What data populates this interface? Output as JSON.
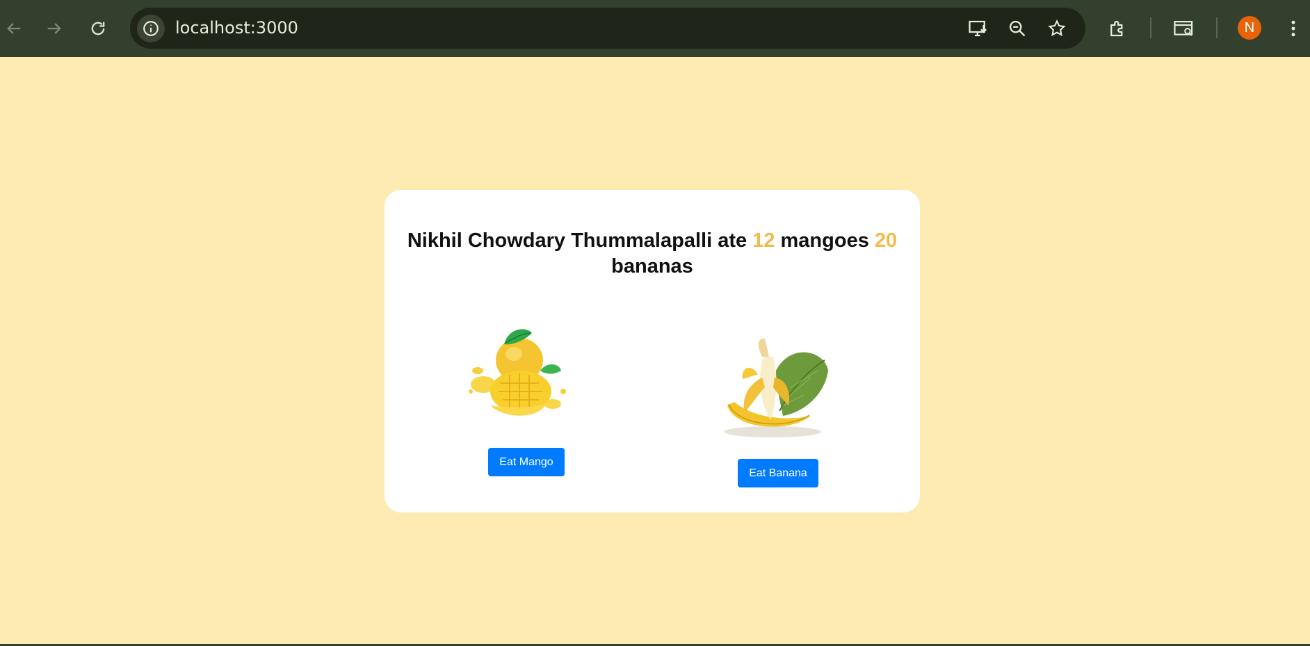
{
  "browser": {
    "url": "localhost:3000",
    "avatar_initial": "N"
  },
  "card": {
    "name": "Nikhil Chowdary Thummalapalli",
    "ate": "ate",
    "mango_count": "12",
    "mangoes_word": "mangoes",
    "banana_count": "20",
    "bananas_word": "bananas",
    "mango_button": "Eat Mango",
    "banana_button": "Eat Banana"
  },
  "colors": {
    "page_background": "#fdebb2",
    "toolbar": "#34402e",
    "count_highlight": "#f2bb4c",
    "button": "#007bff"
  }
}
